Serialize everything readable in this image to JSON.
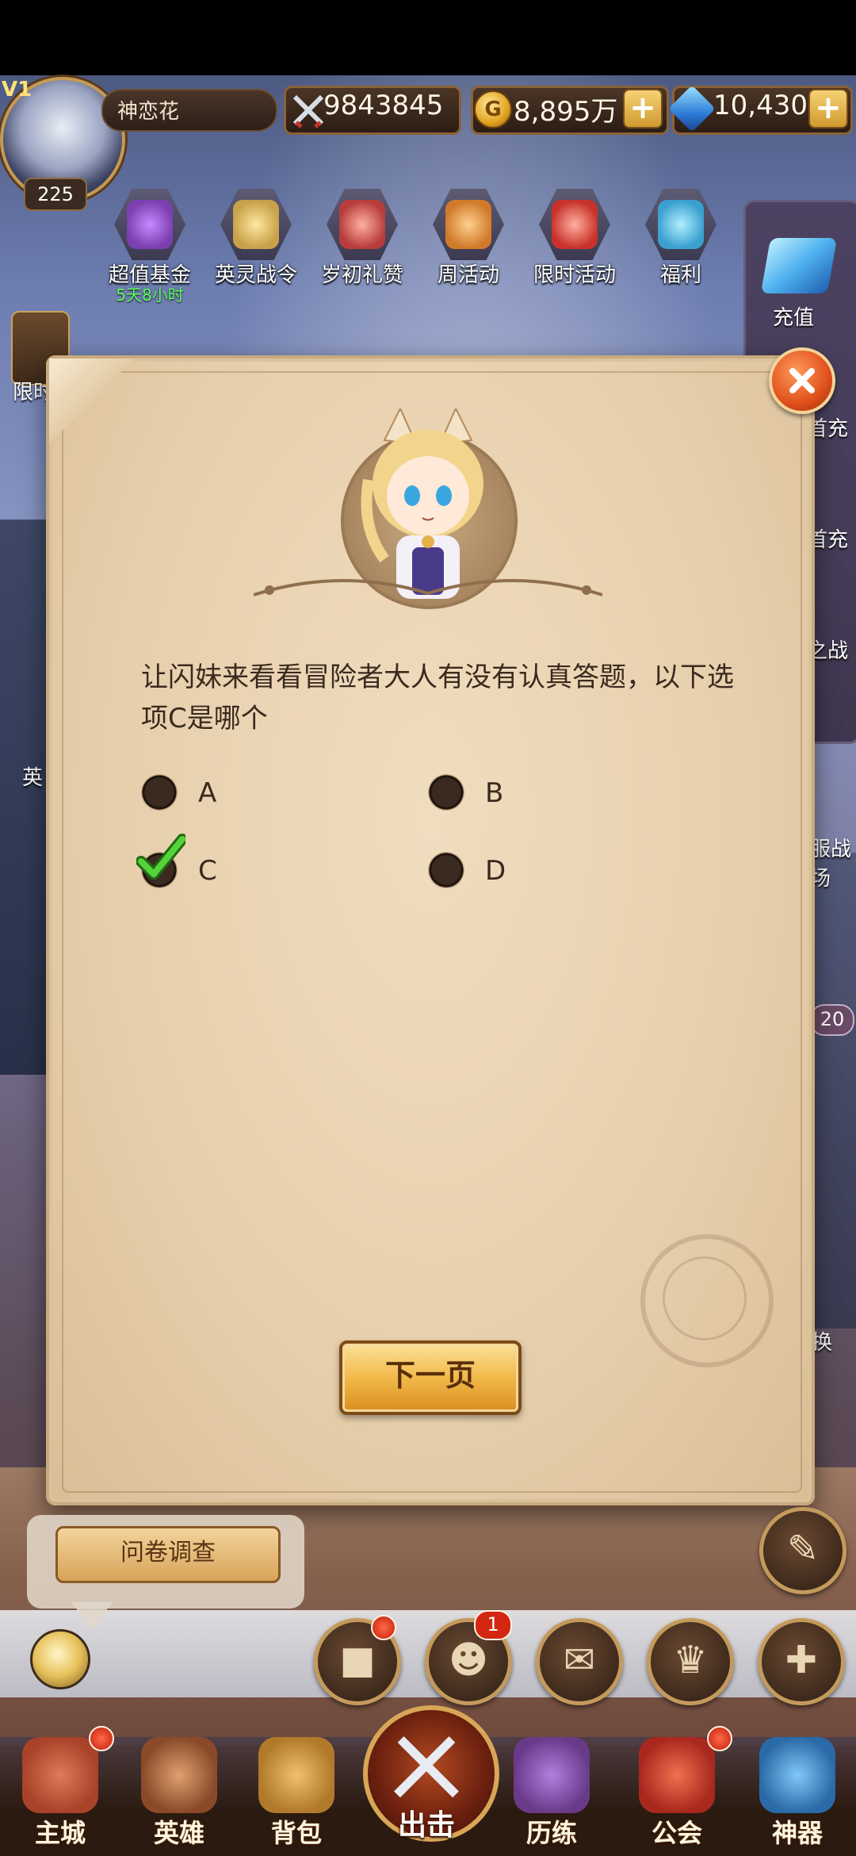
{
  "player": {
    "vip": "V1",
    "level": "225",
    "name": "神恋花",
    "power": "9843845",
    "gold": "8,895万",
    "gold_icon_letter": "G",
    "diamonds": "10,430"
  },
  "activities": [
    {
      "label": "超值基金",
      "sub": "5天8小时",
      "icon": "fund-bag-icon",
      "color": "#7b3fb0"
    },
    {
      "label": "英灵战令",
      "icon": "winged-sword-icon",
      "color": "#c9a14a"
    },
    {
      "label": "岁初礼赞",
      "icon": "plum-blossom-icon",
      "color": "#b83c3c"
    },
    {
      "label": "周活动",
      "icon": "horn-icon",
      "color": "#d07a2a"
    },
    {
      "label": "限时活动",
      "icon": "banner-icon",
      "color": "#c8322a"
    },
    {
      "label": "福利",
      "icon": "gift-box-icon",
      "color": "#3aa0d0"
    }
  ],
  "side": {
    "recharge": "充值",
    "limited_peek": "限时",
    "peek_first_1": "首充",
    "peek_first_2": "首充",
    "peek_battle": "之战",
    "peek_hero": "英",
    "peek_server": "服战场",
    "peek_exchange": "换",
    "badge_count": "20"
  },
  "quiz": {
    "question": "让闪妹来看看冒险者大人有没有认真答题，以下选项C是哪个",
    "options": [
      {
        "label": "A",
        "selected": false
      },
      {
        "label": "B",
        "selected": false
      },
      {
        "label": "C",
        "selected": true
      },
      {
        "label": "D",
        "selected": false
      }
    ],
    "next_label": "下一页"
  },
  "survey": {
    "label": "问卷调查"
  },
  "quick_buttons": {
    "message_badge": "1"
  },
  "nav": [
    {
      "label": "主城",
      "icon": "castle-icon",
      "color": "#a8432a"
    },
    {
      "label": "英雄",
      "icon": "hero-portrait-icon",
      "color": "#8a4a2a"
    },
    {
      "label": "背包",
      "icon": "backpack-icon",
      "color": "#b07a2a"
    },
    {
      "label": "出击",
      "icon": "crossed-swords-icon",
      "color": "#b24a22"
    },
    {
      "label": "历练",
      "icon": "demon-tower-icon",
      "color": "#6a3a8a"
    },
    {
      "label": "公会",
      "icon": "guild-shield-icon",
      "color": "#a8281e"
    },
    {
      "label": "神器",
      "icon": "crystal-artifact-icon",
      "color": "#2a6aa8"
    }
  ]
}
